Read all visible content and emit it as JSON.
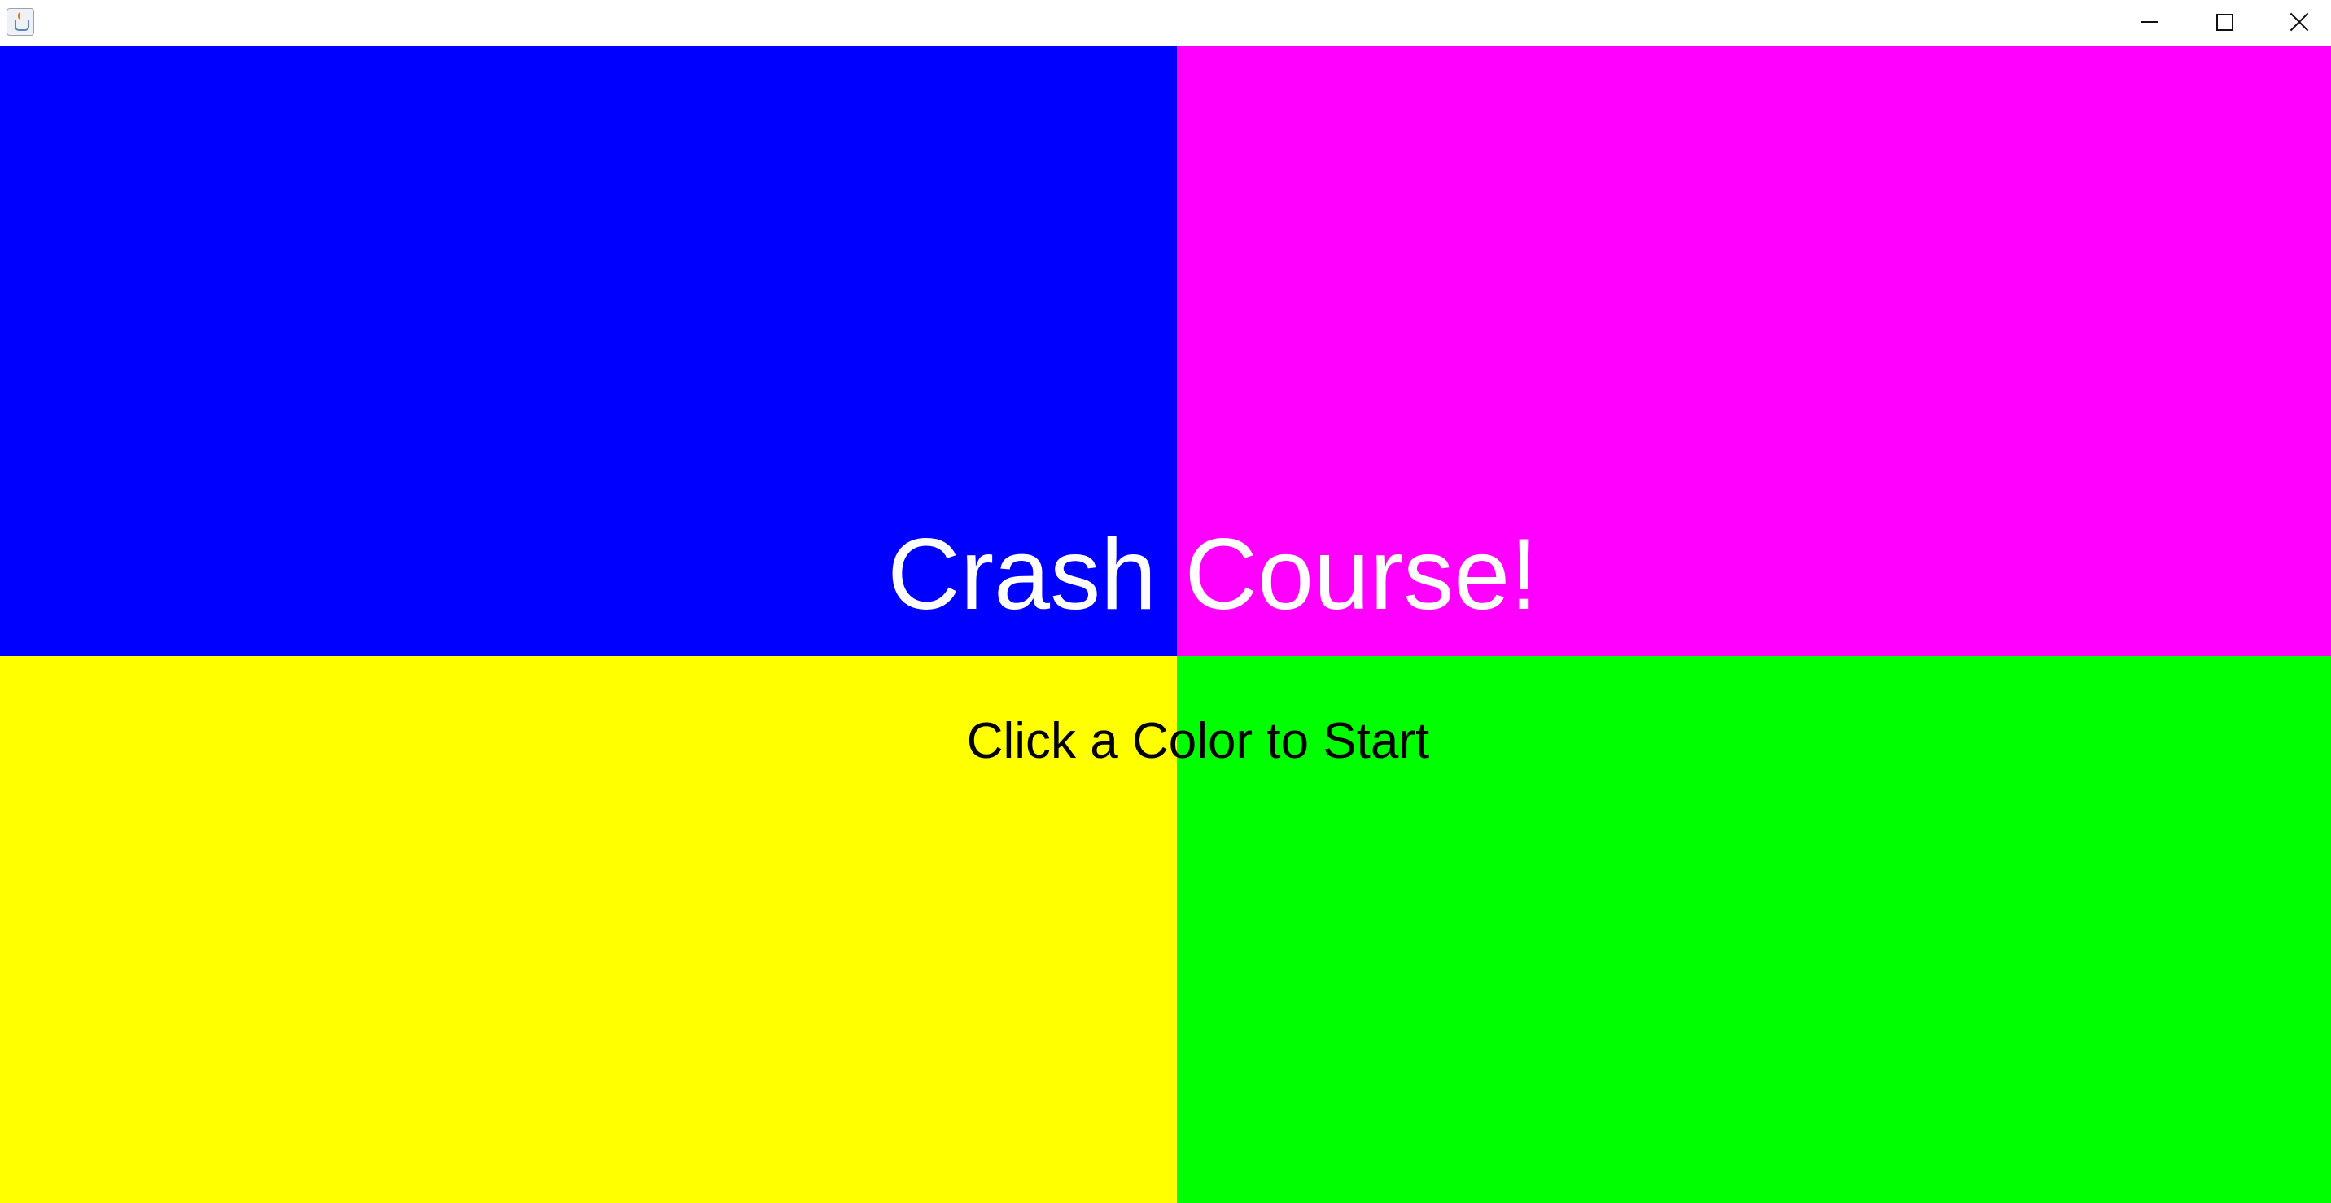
{
  "window": {
    "icon": "java-coffee-cup-icon",
    "controls": {
      "minimize_icon": "minimize-icon",
      "maximize_icon": "maximize-icon",
      "close_icon": "close-icon"
    }
  },
  "game": {
    "title": "Crash Course!",
    "subtitle": "Click a Color to Start",
    "title_color": "#ffffff",
    "subtitle_color": "#000000",
    "quadrants": [
      {
        "name": "blue",
        "color": "#0000ff"
      },
      {
        "name": "magenta",
        "color": "#ff00ff"
      },
      {
        "name": "yellow",
        "color": "#ffff00"
      },
      {
        "name": "green",
        "color": "#00ff00"
      }
    ]
  }
}
